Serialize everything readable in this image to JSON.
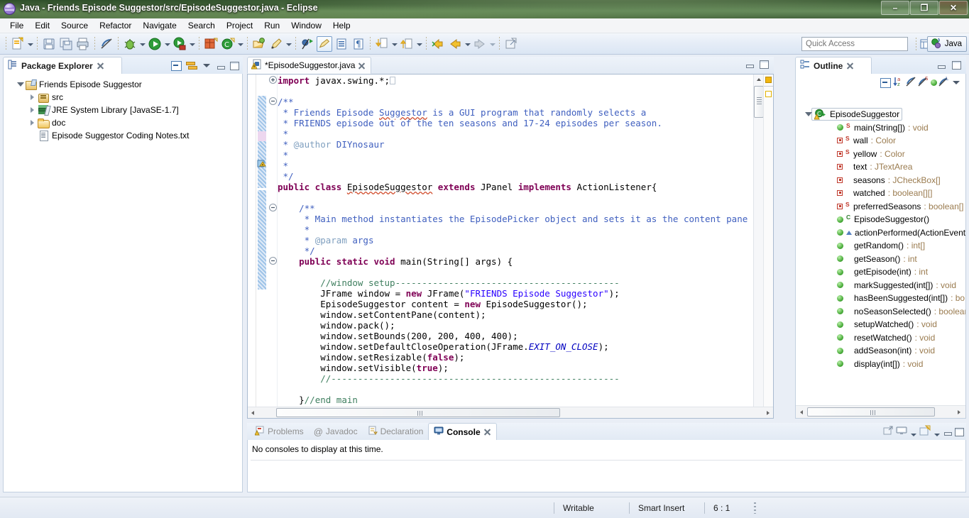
{
  "window": {
    "title": "Java - Friends Episode Suggestor/src/EpisodeSuggestor.java - Eclipse",
    "app_icon": "eclipse-icon",
    "minimize_label": "–",
    "restore_label": "❐",
    "close_label": "✕"
  },
  "menubar": {
    "items": [
      "File",
      "Edit",
      "Source",
      "Refactor",
      "Navigate",
      "Search",
      "Project",
      "Run",
      "Window",
      "Help"
    ]
  },
  "toolbar": {
    "quick_access_placeholder": "Quick Access",
    "quick_access_value": "",
    "perspective_label": "Java",
    "buttons": [
      "new-wizard-icon",
      "save-icon",
      "save-all-icon",
      "print-icon",
      "toggle-mark-occurrences-icon",
      "debug-icon",
      "run-icon",
      "run-coverage-icon",
      "new-java-package-icon",
      "new-java-class-icon",
      "open-type-icon",
      "open-task-icon",
      "skip-all-breakpoints-icon",
      "toggle-java-editor-icon",
      "toggle-breadcrumb-icon",
      "next-annotation-icon",
      "previous-annotation-icon",
      "back-icon",
      "forward-next-icon",
      "new-editor-icon"
    ]
  },
  "package_explorer": {
    "title": "Package Explorer",
    "icon": "package-explorer-icon",
    "toolbar": [
      "collapse-all-icon",
      "link-with-editor-icon",
      "view-menu-icon",
      "minimize-icon",
      "maximize-icon"
    ],
    "tree": [
      {
        "label": "Friends Episode Suggestor",
        "suffix": "",
        "icon": "java-project-icon",
        "depth": 0,
        "twist": "open"
      },
      {
        "label": "src",
        "suffix": "",
        "icon": "source-folder-icon",
        "depth": 1,
        "twist": "closed"
      },
      {
        "label": "JRE System Library",
        "suffix": "[JavaSE-1.7]",
        "icon": "jre-library-icon",
        "depth": 1,
        "twist": "closed"
      },
      {
        "label": "doc",
        "suffix": "",
        "icon": "folder-icon",
        "depth": 1,
        "twist": "closed"
      },
      {
        "label": "Episode Suggestor Coding Notes.txt",
        "suffix": "",
        "icon": "text-file-icon",
        "depth": 1,
        "twist": "none"
      }
    ]
  },
  "editor": {
    "tab_label": "*EpisodeSuggestor.java",
    "tab_icon": "java-file-warning-icon",
    "dirty": true,
    "toolbar": [
      "minimize-icon",
      "maximize-icon"
    ],
    "lines": [
      "import javax.swing.*;",
      "",
      "/**",
      " * Friends Episode Suggestor is a GUI program that randomly selects a",
      " * FRIENDS episode out of the ten seasons and 17-24 episodes per season.",
      " *",
      " * @author DIYnosaur",
      " *",
      " *",
      " */",
      "public class EpisodeSuggestor extends JPanel implements ActionListener{",
      "",
      "    /**",
      "     * Main method instantiates the EpisodePicker object and sets it as the content pane for a ne",
      "     *",
      "     * @param args",
      "     */",
      "    public static void main(String[] args) {",
      "",
      "        //window setup------------------------------------------",
      "        JFrame window = new JFrame(\"FRIENDS Episode Suggestor\");",
      "        EpisodeSuggestor content = new EpisodeSuggestor();",
      "        window.setContentPane(content);",
      "        window.pack();",
      "        window.setBounds(200, 200, 400, 400);",
      "        window.setDefaultCloseOperation(JFrame.EXIT_ON_CLOSE);",
      "        window.setResizable(false);",
      "        window.setVisible(true);",
      "        //------------------------------------------------------",
      "",
      "    }//end main"
    ]
  },
  "outline": {
    "title": "Outline",
    "icon": "outline-icon",
    "toolbar": [
      "collapse-all-icon",
      "sort-icon",
      "hide-fields-icon",
      "hide-static-icon",
      "hide-non-public-icon",
      "hide-local-types-icon",
      "view-menu-icon",
      "minimize-icon",
      "maximize-icon"
    ],
    "root": {
      "label": "EpisodeSuggestor",
      "icon": "java-class-warning-icon",
      "selected": true
    },
    "items": [
      {
        "name": "main(String[])",
        "type": ": void",
        "icon": "public-method-icon",
        "modifier": "S"
      },
      {
        "name": "wall",
        "type": ": Color",
        "icon": "private-field-icon",
        "modifier": "S"
      },
      {
        "name": "yellow",
        "type": ": Color",
        "icon": "private-field-icon",
        "modifier": "S"
      },
      {
        "name": "text",
        "type": ": JTextArea",
        "icon": "private-field-icon",
        "modifier": ""
      },
      {
        "name": "seasons",
        "type": ": JCheckBox[]",
        "icon": "private-field-icon",
        "modifier": ""
      },
      {
        "name": "watched",
        "type": ": boolean[][]",
        "icon": "private-field-icon",
        "modifier": ""
      },
      {
        "name": "preferredSeasons",
        "type": ": boolean[]",
        "icon": "private-field-icon",
        "modifier": "S"
      },
      {
        "name": "EpisodeSuggestor()",
        "type": "",
        "icon": "public-method-icon",
        "modifier": "C"
      },
      {
        "name": "actionPerformed(ActionEvent",
        "type": "",
        "icon": "public-method-icon",
        "modifier": "override"
      },
      {
        "name": "getRandom()",
        "type": ": int[]",
        "icon": "public-method-icon",
        "modifier": ""
      },
      {
        "name": "getSeason()",
        "type": ": int",
        "icon": "public-method-icon",
        "modifier": ""
      },
      {
        "name": "getEpisode(int)",
        "type": ": int",
        "icon": "public-method-icon",
        "modifier": ""
      },
      {
        "name": "markSuggested(int[])",
        "type": ": void",
        "icon": "public-method-icon",
        "modifier": ""
      },
      {
        "name": "hasBeenSuggested(int[])",
        "type": ": bo",
        "icon": "public-method-icon",
        "modifier": ""
      },
      {
        "name": "noSeasonSelected()",
        "type": ": boolean",
        "icon": "public-method-icon",
        "modifier": ""
      },
      {
        "name": "setupWatched()",
        "type": ": void",
        "icon": "public-method-icon",
        "modifier": ""
      },
      {
        "name": "resetWatched()",
        "type": ": void",
        "icon": "public-method-icon",
        "modifier": ""
      },
      {
        "name": "addSeason(int)",
        "type": ": void",
        "icon": "public-method-icon",
        "modifier": ""
      },
      {
        "name": "display(int[])",
        "type": ": void",
        "icon": "public-method-icon",
        "modifier": ""
      }
    ]
  },
  "console_panel": {
    "tabs": [
      {
        "label": "Problems",
        "icon": "problems-icon",
        "active": false
      },
      {
        "label": "Javadoc",
        "icon": "javadoc-icon",
        "active": false
      },
      {
        "label": "Declaration",
        "icon": "declaration-icon",
        "active": false
      },
      {
        "label": "Console",
        "icon": "console-icon",
        "active": true
      }
    ],
    "message": "No consoles to display at this time.",
    "toolbar": [
      "open-console-icon",
      "display-selected-console-icon",
      "display-console-dropdown-icon",
      "new-console-view-icon",
      "new-console-dropdown-icon",
      "minimize-icon",
      "maximize-icon"
    ]
  },
  "statusbar": {
    "writable": "Writable",
    "insert_mode": "Smart Insert",
    "position": "6 : 1"
  },
  "colors": {
    "titlebar_green": "#45663c",
    "accent_blue": "#3d6ea8",
    "keyword": "#7f0055",
    "string": "#2a00ff",
    "comment": "#3f7f5f",
    "javadoc": "#3f5fbf",
    "type_gray": "#9a7b4f"
  }
}
